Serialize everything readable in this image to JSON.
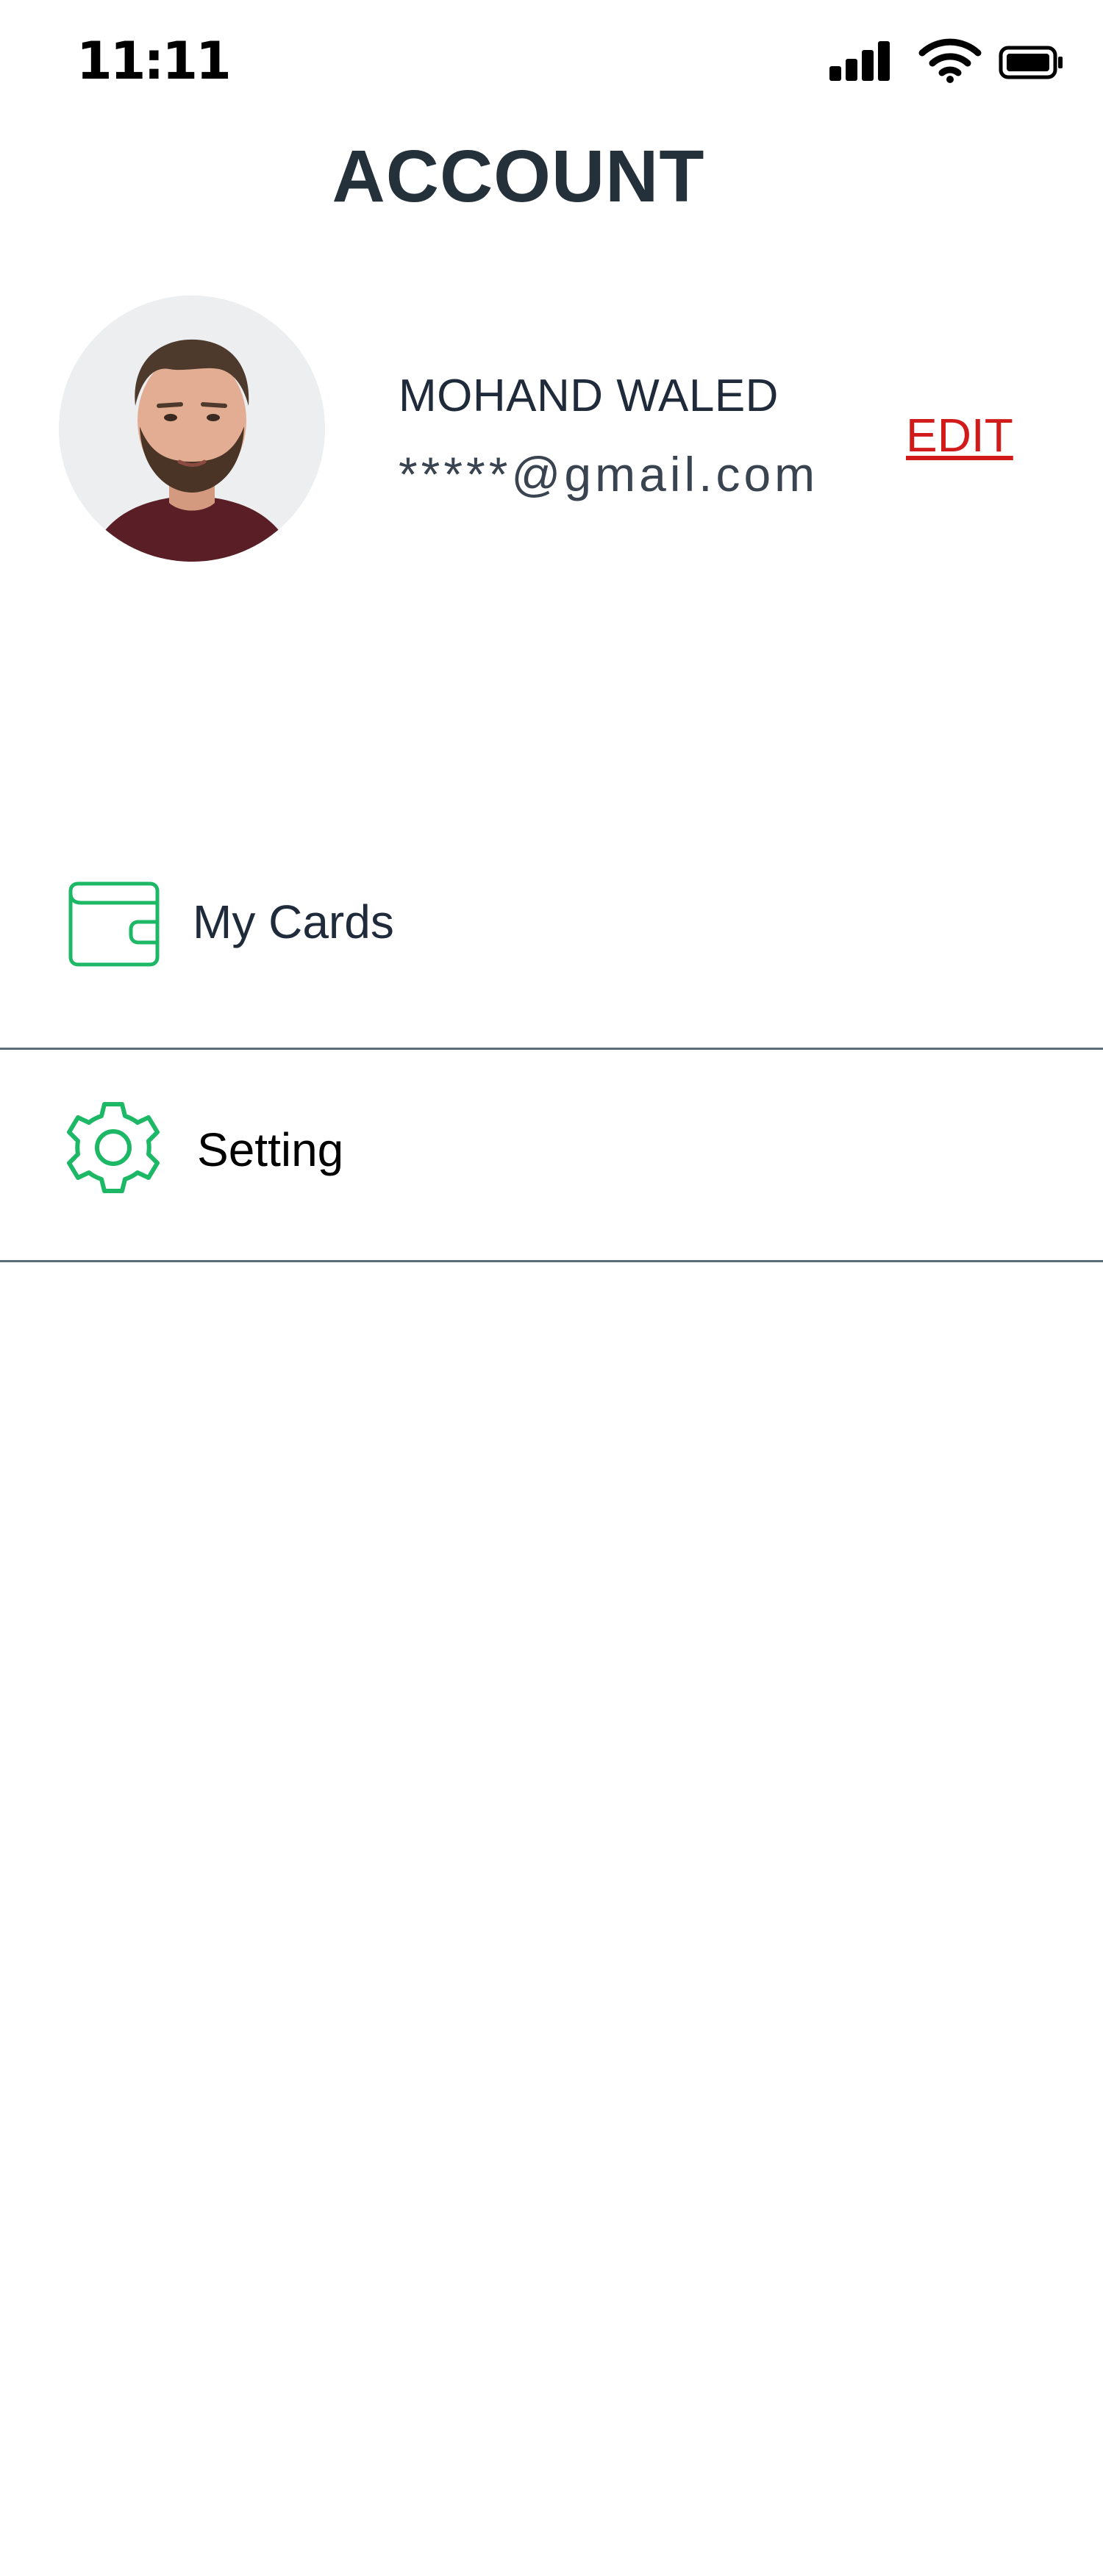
{
  "status_bar": {
    "time": "11:11",
    "signal_icon": "cellular-signal-icon",
    "wifi_icon": "wifi-icon",
    "battery_icon": "battery-icon"
  },
  "header": {
    "title": "ACCOUNT"
  },
  "profile": {
    "name": "MOHAND WALED",
    "email": "*****@gmail.com",
    "edit_label": "EDIT",
    "avatar_icon": "user-avatar-photo"
  },
  "menu": {
    "items": [
      {
        "label": "My Cards",
        "icon": "wallet-icon"
      },
      {
        "label": "Setting",
        "icon": "gear-icon"
      }
    ]
  },
  "colors": {
    "accent_green": "#1db866",
    "edit_red": "#d11a1a",
    "divider": "#5b6e78",
    "title_text": "#25313a"
  }
}
